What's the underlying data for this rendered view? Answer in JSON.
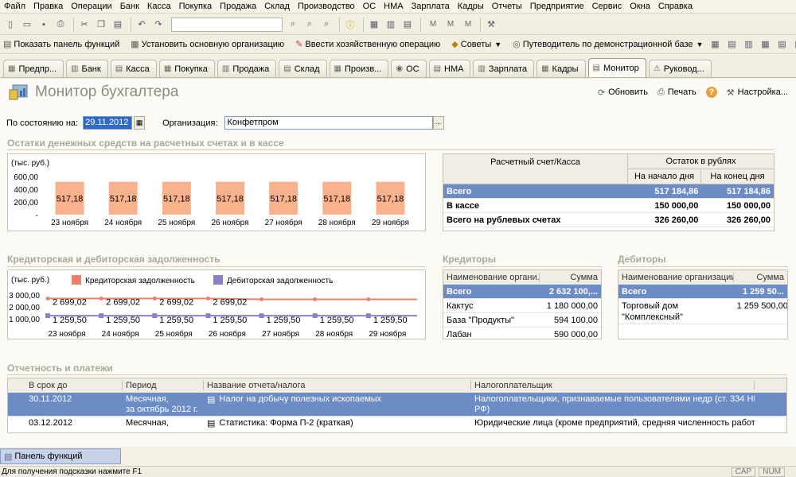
{
  "menu": [
    "Файл",
    "Правка",
    "Операции",
    "Банк",
    "Касса",
    "Покупка",
    "Продажа",
    "Склад",
    "Производство",
    "ОС",
    "НМА",
    "Зарплата",
    "Кадры",
    "Отчеты",
    "Предприятие",
    "Сервис",
    "Окна",
    "Справка"
  ],
  "toolbar2": {
    "show_panel": "Показать панель функций",
    "set_org": "Установить основную организацию",
    "enter_op": "Ввести хозяйственную операцию",
    "tips": "Советы",
    "guide": "Путеводитель по демонстрационной базе"
  },
  "tabs": [
    "Предпр...",
    "Банк",
    "Касса",
    "Покупка",
    "Продажа",
    "Склад",
    "Произв...",
    "ОС",
    "НМА",
    "Зарплата",
    "Кадры",
    "Монитор",
    "Руковод..."
  ],
  "active_tab": "Монитор",
  "page": {
    "title": "Монитор бухгалтера",
    "refresh": "Обновить",
    "print": "Печать",
    "help": "?",
    "settings": "Настройка..."
  },
  "filter": {
    "date_label": "По состоянию на:",
    "date_value": "29.11.2012",
    "org_label": "Организация:",
    "org_value": "Конфетпром"
  },
  "cash": {
    "title": "Остатки денежных средств на расчетных счетах и в кассе",
    "table": {
      "col_account": "Расчетный счет/Касса",
      "col_balance": "Остаток в рублях",
      "col_start": "На начало дня",
      "col_end": "На конец дня",
      "rows": [
        {
          "name": "Всего",
          "start": "517 184,86",
          "end": "517 184,86"
        },
        {
          "name": "В кассе",
          "start": "150 000,00",
          "end": "150 000,00"
        },
        {
          "name": "Всего на рублевых счетах",
          "start": "326 260,00",
          "end": "326 260,00"
        }
      ]
    }
  },
  "debt": {
    "title": "Кредиторская и дебиторская задолженность",
    "creditors_title": "Кредиторы",
    "debtors_title": "Дебиторы",
    "creditors": {
      "col_name": "Наименование органи...",
      "col_sum": "Сумма",
      "rows": [
        {
          "name": "Всего",
          "sum": "2 632 100,..."
        },
        {
          "name": "Кактус",
          "sum": "1 180 000,00"
        },
        {
          "name": "База \"Продукты\"",
          "sum": "594 100,00"
        },
        {
          "name": "Лабан",
          "sum": "590 000,00"
        }
      ]
    },
    "debtors": {
      "col_name": "Наименование организации",
      "col_sum": "Сумма",
      "rows": [
        {
          "name": "Всего",
          "sum": "1 259 50..."
        },
        {
          "name": "Торговый дом",
          "name2": "\"Комплексный\"",
          "sum": "1 259 500,00"
        }
      ]
    }
  },
  "reports": {
    "title": "Отчетность и платежи",
    "cols": [
      "В срок до",
      "Период",
      "Название отчета/налога",
      "Налогоплательщик"
    ],
    "rows": [
      {
        "due": "30.11.2012",
        "period": "Месячная,",
        "period2": "за октябрь 2012 г.",
        "name": "Налог на добычу полезных ископаемых",
        "payer": "Налогоплательщики, признаваемые пользователями недр (ст. 334 НК",
        "payer2": "РФ)"
      },
      {
        "due": "03.12.2012",
        "period": "Месячная,",
        "period2": "",
        "name": "Статистика: Форма П-2 (краткая)",
        "payer": "Юридические лица (кроме предприятий, средняя численность работников",
        "payer2": ""
      }
    ]
  },
  "panel_button": "Панель функций",
  "status": {
    "hint": "Для получения подсказки нажмите F1",
    "cap": "CAP",
    "num": "NUM"
  },
  "chart_data": [
    {
      "type": "bar",
      "ylabel": "(тыс. руб.)",
      "yticks": [
        "600,00",
        "400,00",
        "200,00",
        "-"
      ],
      "ylim": [
        0,
        600
      ],
      "categories": [
        "23 ноября",
        "24 ноября",
        "25 ноября",
        "26 ноября",
        "27 ноября",
        "28 ноября",
        "29 ноября"
      ],
      "values": [
        517.18,
        517.18,
        517.18,
        517.18,
        517.18,
        517.18,
        517.18
      ],
      "value_labels": [
        "517,18",
        "517,18",
        "517,18",
        "517,18",
        "517,18",
        "517,18",
        "517,18"
      ],
      "colors": {
        "bar": "#f9b28c"
      }
    },
    {
      "type": "line",
      "ylabel": "(тыс. руб.)",
      "yticks": [
        "3 000,00",
        "2 000,00",
        "1 000,00"
      ],
      "ylim": [
        0,
        3000
      ],
      "categories": [
        "23 ноября",
        "24 ноября",
        "25 ноября",
        "26 ноября",
        "27 ноября",
        "28 ноября",
        "29 ноября"
      ],
      "series": [
        {
          "name": "Кредиторская задолженность",
          "values": [
            2699.02,
            2699.02,
            2699.02,
            2699.02,
            2632.1,
            2632.1,
            2632.1
          ],
          "labels": [
            "2 699,02",
            "2 699,02",
            "2 699,02",
            "2 699,02",
            "",
            "",
            ""
          ],
          "color": "#e8806a"
        },
        {
          "name": "Дебиторская задолженность",
          "values": [
            1259.5,
            1259.5,
            1259.5,
            1259.5,
            1259.5,
            1259.5,
            1259.5
          ],
          "labels": [
            "1 259,50",
            "1 259,50",
            "1 259,50",
            "1 259,50",
            "1 259,50",
            "1 259,50",
            "1 259,50"
          ],
          "color": "#8a82c8"
        }
      ]
    }
  ]
}
